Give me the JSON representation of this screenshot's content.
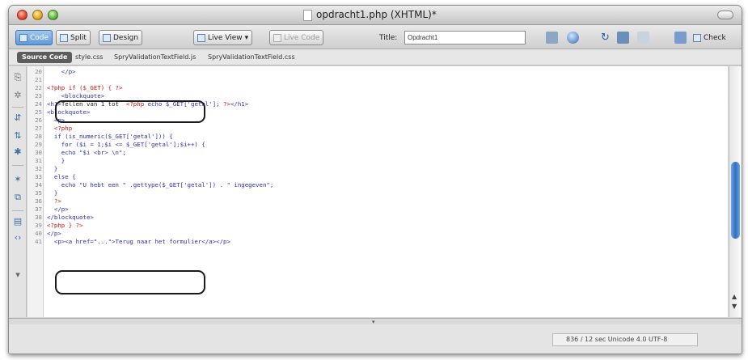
{
  "window": {
    "title": "opdracht1.php (XHTML)*"
  },
  "toolbar": {
    "code_label": "Code",
    "split_label": "Split",
    "design_label": "Design",
    "live_view_label": "Live View",
    "live_code_label": "Live Code",
    "title_label": "Title:",
    "title_value": "Opdracht1",
    "check_label": "Check"
  },
  "related_files": {
    "source_code_label": "Source Code",
    "files": [
      "style.css",
      "SpryValidationTextField.js",
      "SpryValidationTextField.css"
    ]
  },
  "editor": {
    "lines": [
      {
        "n": "20",
        "parts": [
          {
            "c": "tag",
            "t": "    </p>"
          }
        ]
      },
      {
        "n": "21",
        "parts": [
          {
            "c": "plain",
            "t": ""
          }
        ]
      },
      {
        "n": "22",
        "parts": [
          {
            "c": "php",
            "t": "<?php if ($_GET) { ?>"
          }
        ]
      },
      {
        "n": "23",
        "parts": [
          {
            "c": "tag",
            "t": "    <blockquote>"
          }
        ]
      },
      {
        "n": "24",
        "parts": [
          {
            "c": "tag",
            "t": "<h1>"
          },
          {
            "c": "plain",
            "t": "Tellen van 1 tot  "
          },
          {
            "c": "php",
            "t": "<?php"
          },
          {
            "c": "tag",
            "t": " echo $_GET['getal']; "
          },
          {
            "c": "php",
            "t": "?>"
          },
          {
            "c": "tag",
            "t": "</h1>"
          }
        ]
      },
      {
        "n": "25",
        "parts": [
          {
            "c": "tag",
            "t": "<blockquote>"
          }
        ]
      },
      {
        "n": "26",
        "parts": [
          {
            "c": "tag",
            "t": "  <p>"
          }
        ]
      },
      {
        "n": "27",
        "parts": [
          {
            "c": "php",
            "t": "  <?php"
          }
        ]
      },
      {
        "n": "28",
        "parts": [
          {
            "c": "tag",
            "t": "  if (is_numeric($_GET['getal'])) {"
          }
        ]
      },
      {
        "n": "29",
        "parts": [
          {
            "c": "tag",
            "t": "    for ($i = 1;$i <= $_GET['getal'];$i++) {"
          }
        ]
      },
      {
        "n": "30",
        "parts": [
          {
            "c": "tag",
            "t": "    echo \"$i <br> \\n\";"
          }
        ]
      },
      {
        "n": "31",
        "parts": [
          {
            "c": "tag",
            "t": "    }"
          }
        ]
      },
      {
        "n": "32",
        "parts": [
          {
            "c": "tag",
            "t": "  }"
          }
        ]
      },
      {
        "n": "33",
        "parts": [
          {
            "c": "tag",
            "t": "  else {"
          }
        ]
      },
      {
        "n": "34",
        "parts": [
          {
            "c": "tag",
            "t": "    echo \"U hebt een \" .gettype($_GET['getal']) . \" ingegeven\";"
          }
        ]
      },
      {
        "n": "35",
        "parts": [
          {
            "c": "tag",
            "t": "  }"
          }
        ]
      },
      {
        "n": "36",
        "parts": [
          {
            "c": "php",
            "t": "  ?>"
          }
        ]
      },
      {
        "n": "37",
        "parts": [
          {
            "c": "tag",
            "t": "  </p>"
          }
        ]
      },
      {
        "n": "38",
        "parts": [
          {
            "c": "tag",
            "t": "</blockquote>"
          }
        ]
      },
      {
        "n": "39",
        "parts": [
          {
            "c": "php",
            "t": "<?php } ?>"
          }
        ]
      },
      {
        "n": "40",
        "parts": [
          {
            "c": "tag",
            "t": "</p>"
          }
        ]
      },
      {
        "n": "41",
        "parts": [
          {
            "c": "tag",
            "t": "  <p><a href=\"...\">Terug naar het formulier</a></p>"
          }
        ]
      }
    ]
  },
  "status": {
    "text": "836 / 12 sec  Unicode 4.0 UTF-8"
  },
  "colors": {
    "tag": "#2d2dbb",
    "php": "#cc1010",
    "scroll_thumb": "#2d6fc2"
  }
}
